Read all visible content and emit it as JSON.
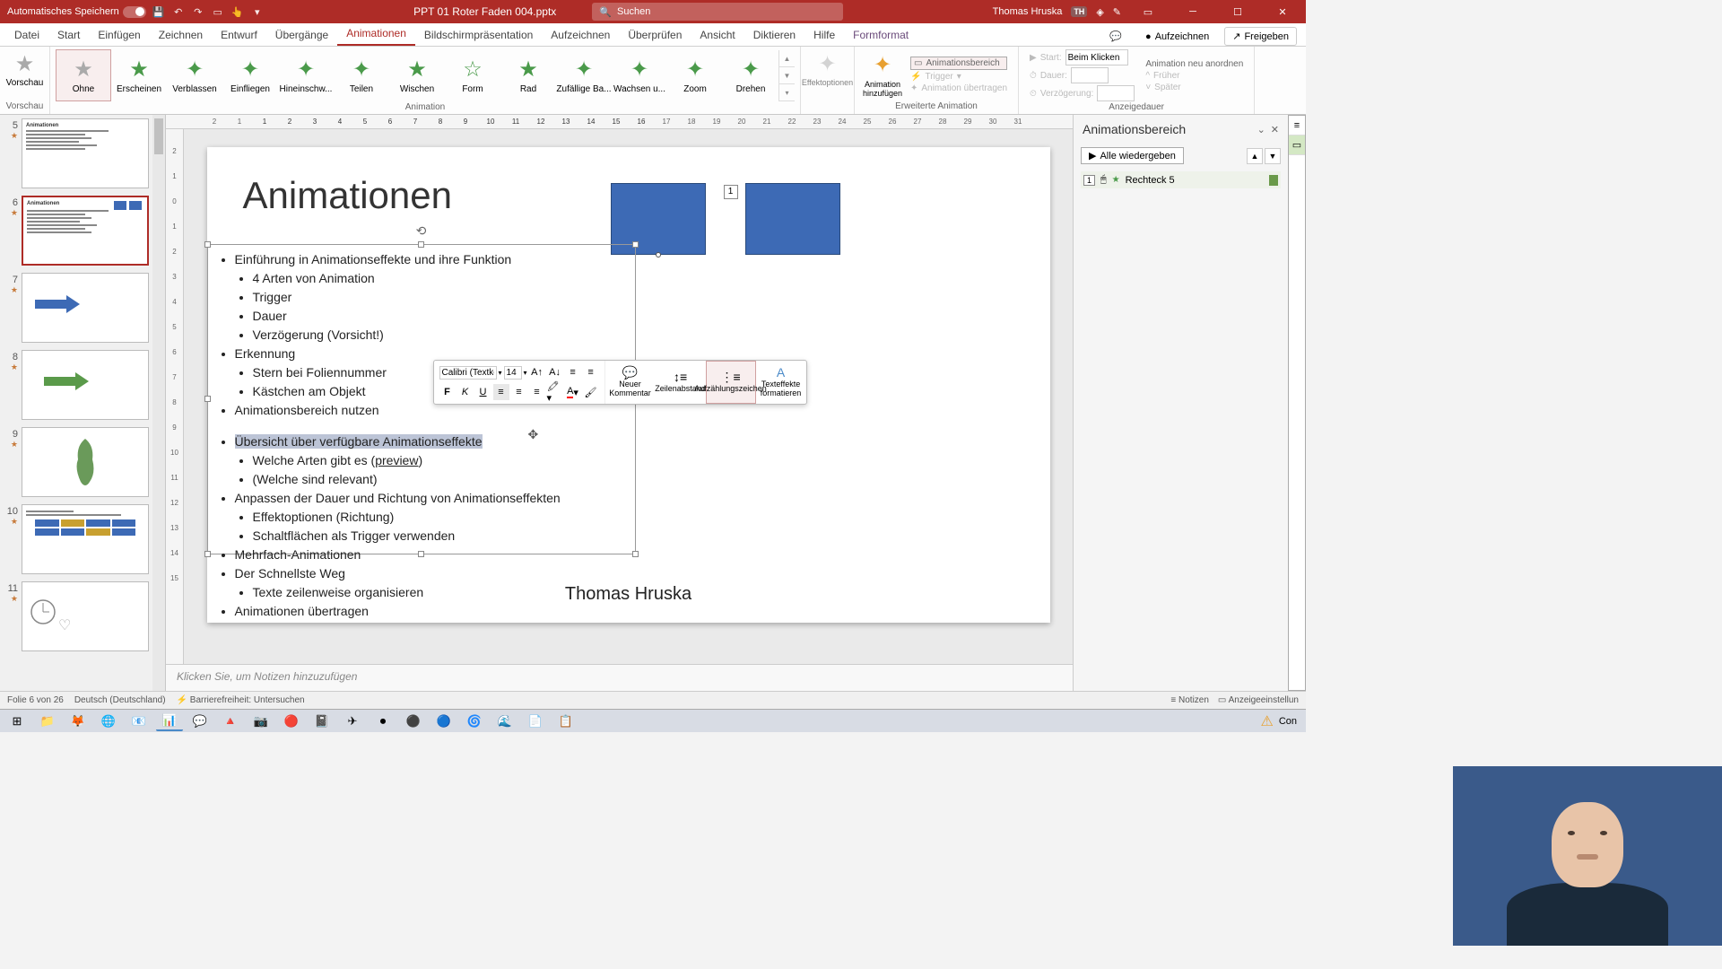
{
  "titleBar": {
    "autosave": "Automatisches Speichern",
    "filename": "PPT 01 Roter Faden 004.pptx",
    "searchPlaceholder": "Suchen",
    "username": "Thomas Hruska",
    "userInitials": "TH"
  },
  "tabs": {
    "file": "Datei",
    "home": "Start",
    "insert": "Einfügen",
    "draw": "Zeichnen",
    "design": "Entwurf",
    "transitions": "Übergänge",
    "animations": "Animationen",
    "slideshow": "Bildschirmpräsentation",
    "record": "Aufzeichnen",
    "review": "Überprüfen",
    "view": "Ansicht",
    "dictate": "Diktieren",
    "help": "Hilfe",
    "shapeFormat": "Formformat",
    "recordBtn": "Aufzeichnen",
    "share": "Freigeben"
  },
  "ribbon": {
    "preview": "Vorschau",
    "previewGroup": "Vorschau",
    "ohne": "Ohne",
    "erscheinen": "Erscheinen",
    "verblassen": "Verblassen",
    "einfliegen": "Einfliegen",
    "hineinschw": "Hineinschw...",
    "teilen": "Teilen",
    "wischen": "Wischen",
    "form": "Form",
    "rad": "Rad",
    "zufaellig": "Zufällige Ba...",
    "wachsen": "Wachsen u...",
    "zoom": "Zoom",
    "drehen": "Drehen",
    "animationGroup": "Animation",
    "effectOptions": "Effektoptionen",
    "addAnimation": "Animation hinzufügen",
    "animPane": "Animationsbereich",
    "trigger": "Trigger",
    "copyAnim": "Animation übertragen",
    "advGroup": "Erweiterte Animation",
    "start": "Start:",
    "startVal": "Beim Klicken",
    "duration": "Dauer:",
    "delay": "Verzögerung:",
    "reorder": "Animation neu anordnen",
    "earlier": "Früher",
    "later": "Später",
    "timingGroup": "Anzeigedauer"
  },
  "thumbs": {
    "n5": "5",
    "n6": "6",
    "n7": "7",
    "n8": "8",
    "n9": "9",
    "n10": "10",
    "n11": "11",
    "t5": "Animationen",
    "t6": "Animationen"
  },
  "slide": {
    "title": "Animationen",
    "footer": "Thomas Hruska",
    "animTag": "1",
    "bullets": {
      "b1": "Einführung in Animationseffekte und ihre Funktion",
      "b1a": "4 Arten von Animation",
      "b1b": "Trigger",
      "b1c": "Dauer",
      "b1d": "Verzögerung (Vorsicht!)",
      "b2": "Erkennung",
      "b2a": "Stern bei Foliennummer",
      "b2b": "Kästchen am Objekt",
      "b3": "Animationsbereich nutzen",
      "b4": "Übersicht über verfügbare Animationseffekte",
      "b4a_pre": "Welche Arten gibt es (",
      "b4a_link": "preview",
      "b4a_post": ")",
      "b4b": "(Welche sind relevant)",
      "b5": "Anpassen der Dauer und Richtung von Animationseffekten",
      "b5a": "Effektoptionen (Richtung)",
      "b5b": "Schaltflächen als Trigger verwenden",
      "b6": "Mehrfach-Animationen",
      "b7": "Der Schnellste Weg",
      "b7a": "Texte zeilenweise organisieren",
      "b8": "Animationen übertragen"
    }
  },
  "miniToolbar": {
    "font": "Calibri (Textkö",
    "size": "14",
    "newComment": "Neuer Kommentar",
    "lineSpacing": "Zeilenabstand",
    "bullets": "Aufzählungszeichen",
    "textEffects": "Texteffekte formatieren"
  },
  "notes": "Klicken Sie, um Notizen hinzuzufügen",
  "animPane": {
    "title": "Animationsbereich",
    "playAll": "Alle wiedergeben",
    "itemTag": "1",
    "itemName": "Rechteck 5"
  },
  "status": {
    "slideOf": "Folie 6 von 26",
    "lang": "Deutsch (Deutschland)",
    "access": "Barrierefreiheit: Untersuchen",
    "notes": "Notizen",
    "display": "Anzeigeeinstellun"
  },
  "taskbar": {
    "con": "Con"
  }
}
